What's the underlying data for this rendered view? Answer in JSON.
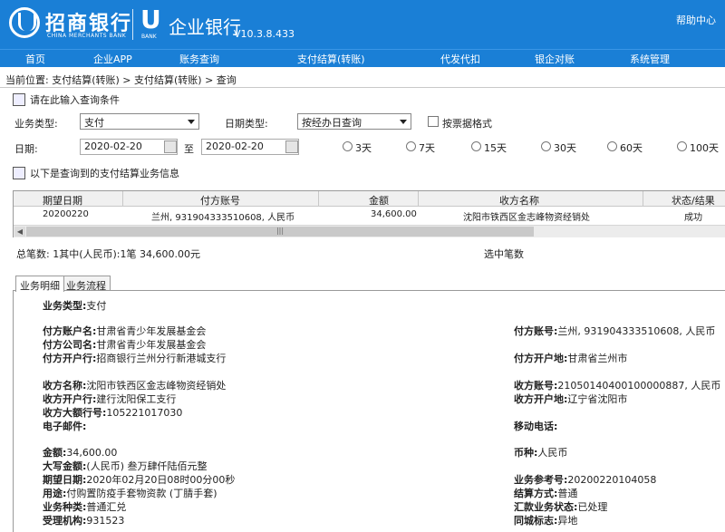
{
  "header": {
    "bank_name": "招商银行",
    "bank_name_en": "CHINA MERCHANTS BANK",
    "u_brand": "U",
    "u_brand_sub": "BANK",
    "product_name": "企业银行",
    "version": "V10.3.8.433",
    "help": "帮助中心"
  },
  "nav": [
    "首页",
    "企业APP",
    "账务查询",
    "支付结算(转账)",
    "代发代扣",
    "银企对账",
    "系统管理"
  ],
  "breadcrumb": "当前位置: 支付结算(转账) > 支付结算(转账) > 查询",
  "query": {
    "title": "请在此输入查询条件",
    "biz_type_label": "业务类型:",
    "biz_type_value": "支付",
    "date_type_label": "日期类型:",
    "date_type_value": "按经办日查询",
    "receipt_format_label": "按票据格式",
    "date_label": "日期:",
    "date_from": "2020-02-20",
    "to_label": "至",
    "date_to": "2020-02-20",
    "ranges": [
      "3天",
      "7天",
      "15天",
      "30天",
      "60天",
      "100天"
    ]
  },
  "results": {
    "title": "以下是查询到的支付结算业务信息",
    "columns": [
      "期望日期",
      "付方账号",
      "金额",
      "收方名称",
      "状态/结果"
    ],
    "rows": [
      [
        "20200220",
        "兰州, 931904333510608, 人民币",
        "34,600.00",
        "沈阳市铁西区金志峰物资经销处",
        "成功"
      ]
    ],
    "scroll_marker": "|||"
  },
  "summary": {
    "total": "总笔数: 1其中(人民币):1笔  34,600.00元",
    "selected": "选中笔数"
  },
  "tabs": [
    "业务明细",
    "业务流程"
  ],
  "detail": {
    "biz_type": {
      "label": "业务类型:",
      "value": "支付"
    },
    "payer_name": {
      "label": "付方账户名:",
      "value": "甘肃省青少年发展基金会"
    },
    "payer_company": {
      "label": "付方公司名:",
      "value": "甘肃省青少年发展基金会"
    },
    "payer_bank": {
      "label": "付方开户行:",
      "value": "招商银行兰州分行新港城支行"
    },
    "payer_account": {
      "label": "付方账号:",
      "value": "兰州, 931904333510608, 人民币"
    },
    "payer_location": {
      "label": "付方开户地:",
      "value": "甘肃省兰州市"
    },
    "payee_name": {
      "label": "收方名称:",
      "value": "沈阳市铁西区金志峰物资经销处"
    },
    "payee_bank": {
      "label": "收方开户行:",
      "value": "建行沈阳保工支行"
    },
    "payee_big_bank_no": {
      "label": "收方大额行号:",
      "value": "105221017030"
    },
    "email": {
      "label": "电子邮件:",
      "value": ""
    },
    "payee_account": {
      "label": "收方账号:",
      "value": "21050140400100000887, 人民币"
    },
    "payee_location": {
      "label": "收方开户地:",
      "value": "辽宁省沈阳市"
    },
    "mobile": {
      "label": "移动电话:",
      "value": ""
    },
    "amount": {
      "label": "金额:",
      "value": "34,600.00"
    },
    "amount_upper": {
      "label": "大写金额:",
      "value": "(人民币) 叁万肆仟陆佰元整"
    },
    "expected_date": {
      "label": "期望日期:",
      "value": "2020年02月20日08时00分00秒"
    },
    "purpose": {
      "label": "用途:",
      "value": "付购置防疫手套物资款 (丁腈手套)"
    },
    "biz_kind": {
      "label": "业务种类:",
      "value": "普通汇兑"
    },
    "handler": {
      "label": "受理机构:",
      "value": "931523"
    },
    "currency": {
      "label": "币种:",
      "value": "人民币"
    },
    "biz_ref": {
      "label": "业务参考号:",
      "value": "20200220104058"
    },
    "settle_mode": {
      "label": "结算方式:",
      "value": "普通"
    },
    "remit_status": {
      "label": "汇款业务状态:",
      "value": "已处理"
    },
    "same_city": {
      "label": "同城标志:",
      "value": "异地"
    }
  }
}
